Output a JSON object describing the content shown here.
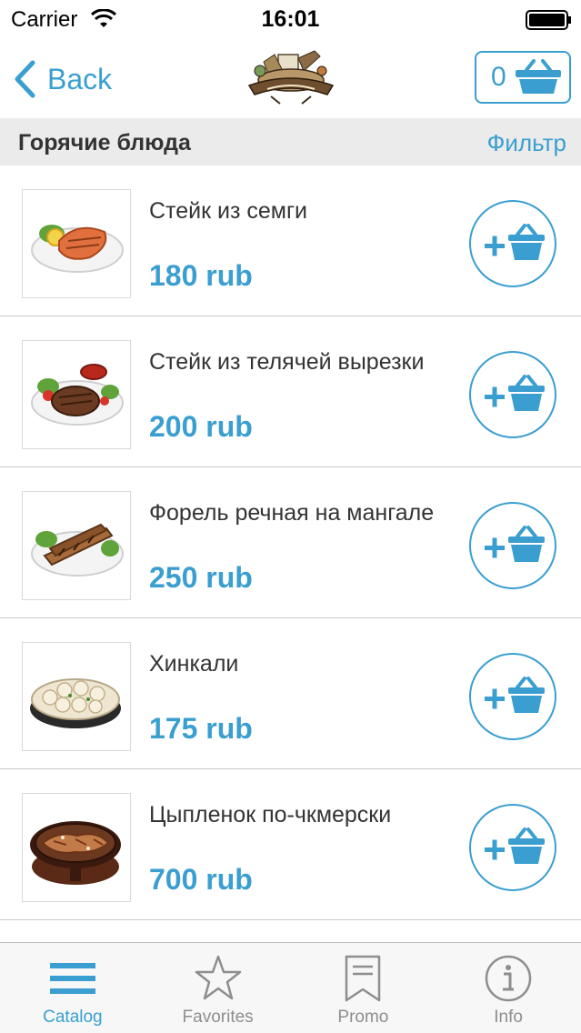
{
  "status_bar": {
    "carrier": "Carrier",
    "time": "16:01"
  },
  "nav": {
    "back_label": "Back",
    "cart_count": "0"
  },
  "section": {
    "title": "Горячие блюда",
    "filter_label": "Фильтр"
  },
  "items": [
    {
      "name": "Стейк из семги",
      "price": "180 rub"
    },
    {
      "name": "Стейк из телячей вырезки",
      "price": "200 rub"
    },
    {
      "name": "Форель речная на мангале",
      "price": "250 rub"
    },
    {
      "name": "Хинкали",
      "price": "175 rub"
    },
    {
      "name": "Цыпленок по-чкмерски",
      "price": "700 rub"
    }
  ],
  "tabs": [
    {
      "label": "Catalog",
      "icon": "menu-icon"
    },
    {
      "label": "Favorites",
      "icon": "star-icon"
    },
    {
      "label": "Promo",
      "icon": "bookmark-icon"
    },
    {
      "label": "Info",
      "icon": "info-icon"
    }
  ],
  "colors": {
    "accent": "#3a9fd0",
    "section_bg": "#ebebeb",
    "tab_inactive": "#8e8e8e"
  }
}
